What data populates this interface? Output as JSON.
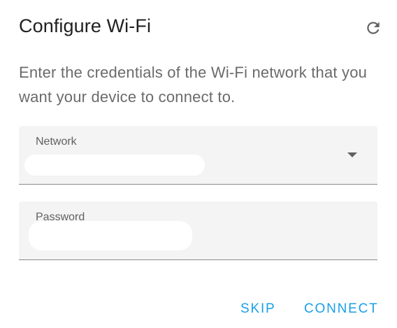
{
  "dialog": {
    "title": "Configure Wi-Fi",
    "refresh_icon": "refresh-icon",
    "description": "Enter the credentials of the Wi-Fi network that you want your device to connect to.",
    "network_field": {
      "label": "Network",
      "value": "",
      "dropdown_icon": "dropdown-arrow-icon"
    },
    "password_field": {
      "label": "Password",
      "value": ""
    },
    "actions": {
      "skip_label": "SKIP",
      "connect_label": "CONNECT"
    },
    "colors": {
      "accent": "#1aa0e6",
      "field_background": "#f4f4f4",
      "title_text": "#212121",
      "body_text": "#6b6b6b"
    }
  }
}
